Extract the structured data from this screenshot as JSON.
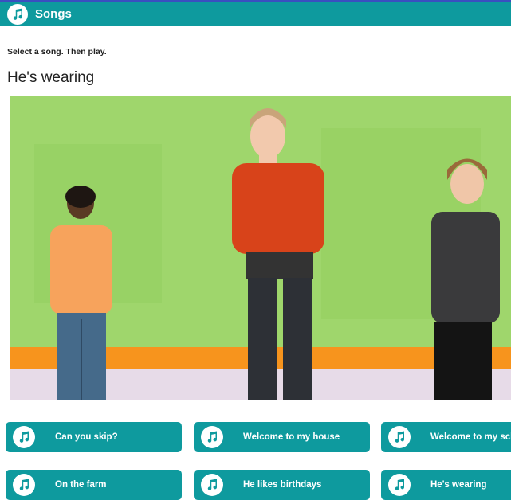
{
  "header": {
    "title": "Songs",
    "icon": "music-note-icon"
  },
  "instruction": "Select a song. Then play.",
  "current_song": "He's wearing",
  "video": {
    "description_icon": "video-player"
  },
  "songs": [
    {
      "label": "Can you skip?",
      "icon": "music-note-icon"
    },
    {
      "label": "Welcome to my house",
      "icon": "music-note-icon"
    },
    {
      "label": "Welcome to my school",
      "icon": "music-note-icon"
    },
    {
      "label": "On the farm",
      "icon": "music-note-icon"
    },
    {
      "label": "He likes birthdays",
      "icon": "music-note-icon"
    },
    {
      "label": "He's wearing",
      "icon": "music-note-icon"
    }
  ],
  "colors": {
    "accent": "#0e9a9e",
    "top_strip": "#3a4fc0"
  }
}
